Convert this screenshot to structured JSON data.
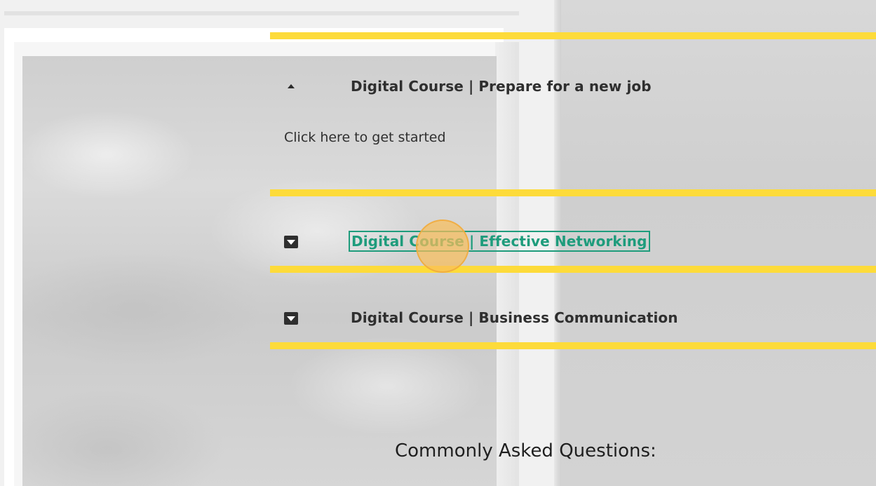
{
  "accordion": {
    "items": [
      {
        "title": "Digital Course | Prepare for a new job",
        "state": "expanded",
        "icon": "caret-up-icon",
        "body": "Click here to get started"
      },
      {
        "title": "Digital Course | Effective Networking",
        "state": "collapsed",
        "icon": "caret-down-box-icon",
        "highlighted": true
      },
      {
        "title": "Digital Course | Business Communication",
        "state": "collapsed",
        "icon": "caret-down-box-icon"
      }
    ]
  },
  "section": {
    "heading": "Commonly Asked Questions:"
  },
  "colors": {
    "separator": "#fddb3a",
    "highlight": "#1e9c7c",
    "click_indicator": "#f8be5a",
    "text": "#2f2f2f"
  }
}
